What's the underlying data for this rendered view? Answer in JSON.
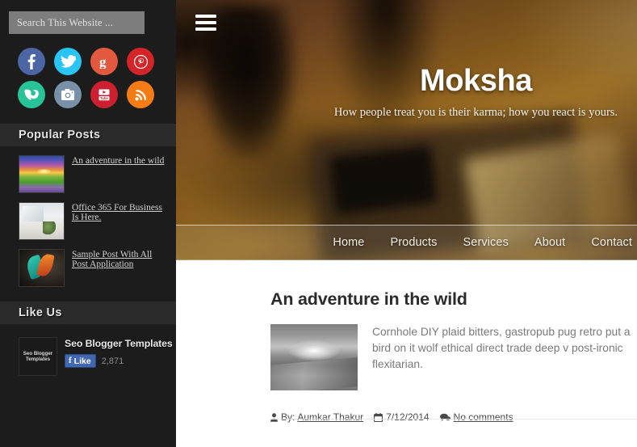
{
  "sidebar": {
    "search": {
      "placeholder": "Search This Website ...",
      "value": ""
    },
    "social": [
      {
        "name": "facebook",
        "label": "Facebook",
        "color": "#4c66a4"
      },
      {
        "name": "twitter",
        "label": "Twitter",
        "color": "#29c5f6"
      },
      {
        "name": "google-plus",
        "label": "Google Plus",
        "color": "#e2593f"
      },
      {
        "name": "pinterest",
        "label": "Pinterest",
        "color": "#d42428"
      },
      {
        "name": "vine",
        "label": "Vine",
        "color": "#27c498"
      },
      {
        "name": "instagram",
        "label": "Instagram",
        "color": "#7890a8"
      },
      {
        "name": "youtube",
        "label": "YouTube",
        "color": "#cc1f2f"
      },
      {
        "name": "rss",
        "label": "RSS Feed",
        "color": "#f57c14"
      }
    ],
    "popular_posts": {
      "heading": "Popular Posts",
      "items": [
        {
          "title": "An adventure in the wild",
          "thumb": "sunset-landscape"
        },
        {
          "title": "Office 365 For Business Is Here.",
          "thumb": "office-interior"
        },
        {
          "title": "Sample Post With All Post Application",
          "thumb": "feathers"
        }
      ]
    },
    "like_us": {
      "heading": "Like Us",
      "page_name": "Seo Blogger Templates",
      "logo_text": "Seo Blogger Templates",
      "like_label": "Like",
      "like_count": "2,871"
    }
  },
  "hero": {
    "menu_icon": "hamburger-icon",
    "title": "Moksha",
    "tagline": "How people treat you is their karma; how you react is yours.",
    "nav": [
      {
        "label": "Home"
      },
      {
        "label": "Products"
      },
      {
        "label": "Services"
      },
      {
        "label": "About"
      },
      {
        "label": "Contact"
      }
    ]
  },
  "post": {
    "title": "An adventure in the wild",
    "excerpt": "Cornhole DIY plaid bitters, gastropub pug retro put a bird on it wolf ethical direct trade deep v post-ironic flexitarian.",
    "thumb": "monochrome-landscape",
    "meta": {
      "by_label": "By:",
      "author": "Aumkar Thakur",
      "date": "7/12/2014",
      "comments": "No comments"
    }
  },
  "colors": {
    "sidebar_bg": "#1c1c1c",
    "widget_head_bg": "#2b2b2b",
    "content_bg": "#ffffff",
    "accent_gold": "#a8792a"
  }
}
